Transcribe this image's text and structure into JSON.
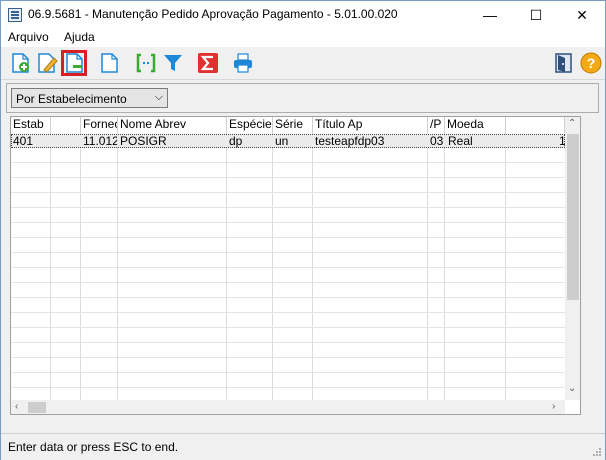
{
  "window": {
    "title": "06.9.5681 - Manutenção Pedido Aprovação Pagamento - 5.01.00.020",
    "minimize": "—",
    "maximize": "☐",
    "close": "✕"
  },
  "menu": {
    "items": [
      "Arquivo",
      "Ajuda"
    ]
  },
  "toolbar": {
    "buttons": [
      {
        "icon": "add-document-icon"
      },
      {
        "icon": "edit-document-icon"
      },
      {
        "icon": "remove-document-icon",
        "selected": true
      },
      {
        "icon": "blank-document-icon"
      },
      {
        "icon": "bracket-range-icon"
      },
      {
        "icon": "filter-icon"
      },
      {
        "icon": "sigma-icon"
      },
      {
        "icon": "printer-icon"
      },
      {
        "icon": "exit-door-icon"
      },
      {
        "icon": "help-icon"
      }
    ],
    "colors": {
      "selected_border": "#d81f26",
      "accent_blue": "#1e88d8",
      "accent_green": "#3aaa35",
      "accent_red": "#e03030"
    }
  },
  "filter": {
    "selected": "Por Estabelecimento"
  },
  "grid": {
    "columns": [
      "Estab",
      "Fornec",
      "Nome Abrev",
      "Espécie",
      "Série",
      "Título Ap",
      "/P",
      "Moeda"
    ],
    "rows": [
      [
        "401",
        "11.012",
        "POSIGR",
        "dp",
        "un",
        "testeapfdp03",
        "03",
        "Real",
        "1"
      ]
    ]
  },
  "status": {
    "text": "Enter data or press ESC to end."
  }
}
